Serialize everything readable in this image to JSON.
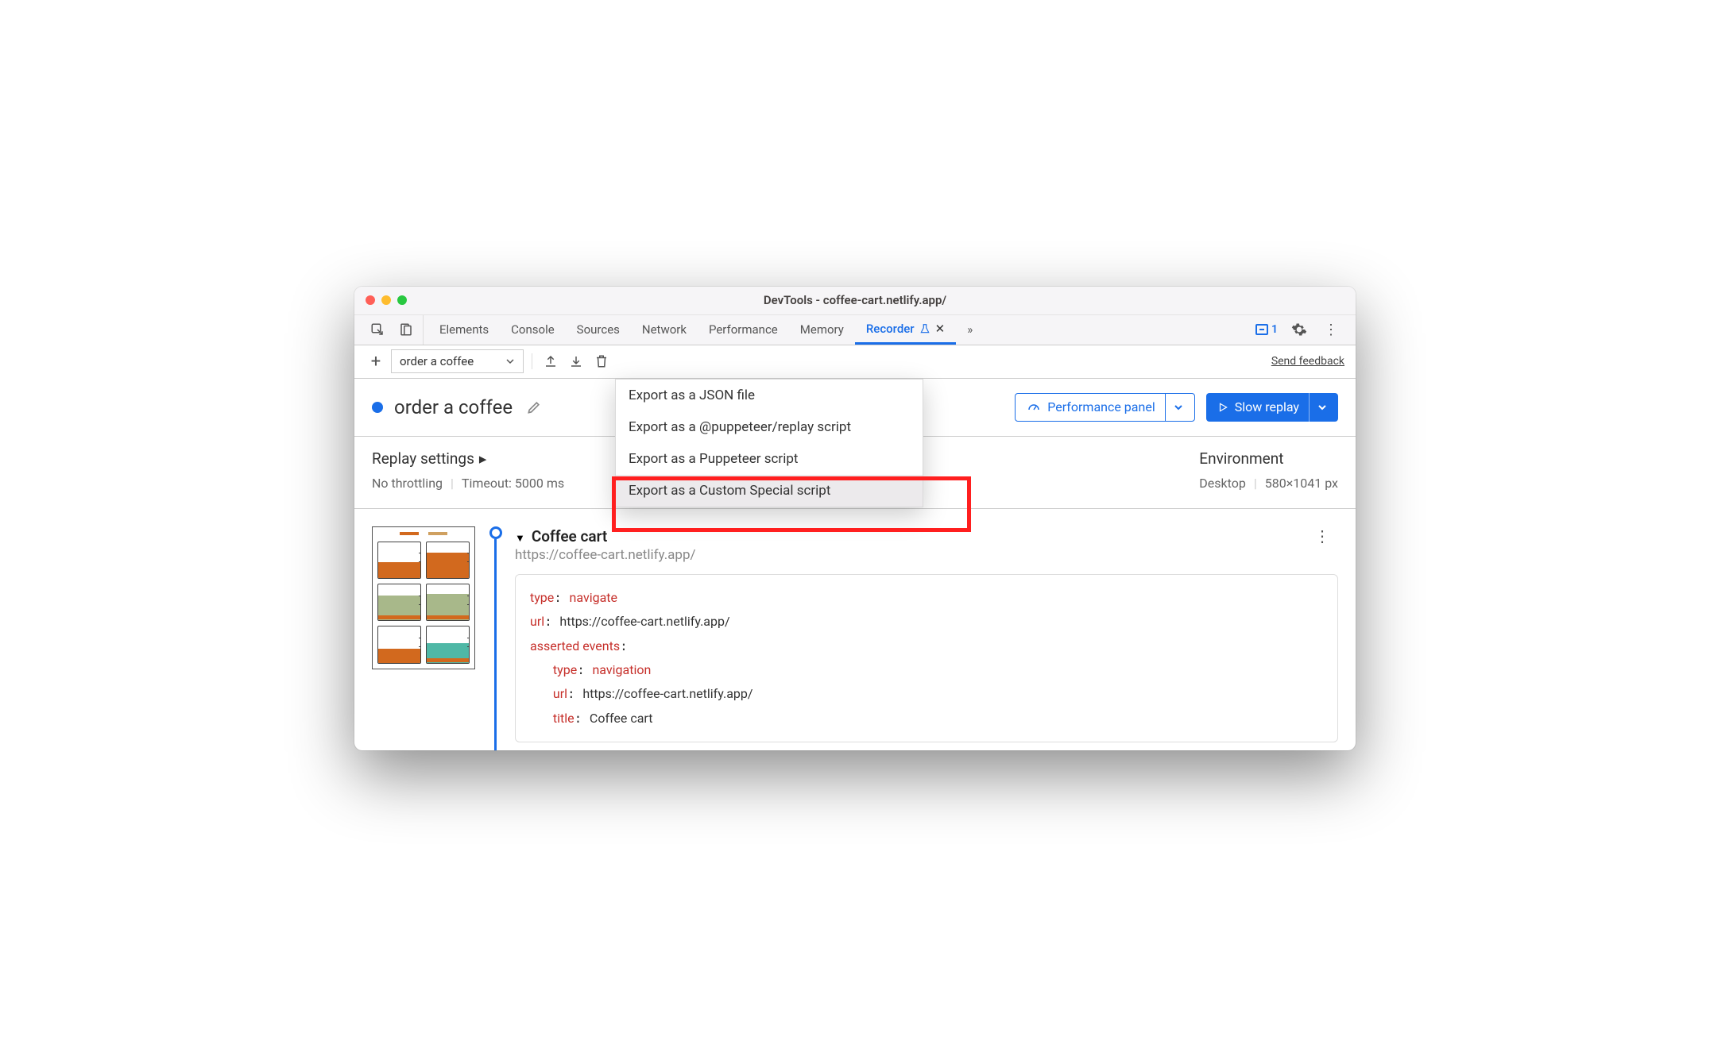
{
  "window": {
    "title": "DevTools - coffee-cart.netlify.app/"
  },
  "tabs": {
    "items": [
      "Elements",
      "Console",
      "Sources",
      "Network",
      "Performance",
      "Memory",
      "Recorder"
    ],
    "active": "Recorder",
    "issues_count": "1"
  },
  "toolbar": {
    "recording_name": "order a coffee",
    "feedback_label": "Send feedback"
  },
  "export_menu": {
    "items": [
      "Export as a JSON file",
      "Export as a @puppeteer/replay script",
      "Export as a Puppeteer script",
      "Export as a Custom Special script"
    ]
  },
  "header": {
    "title": "order a coffee",
    "perf_button": "Performance panel",
    "replay_button": "Slow replay"
  },
  "settings": {
    "title": "Replay settings",
    "throttling": "No throttling",
    "timeout": "Timeout: 5000 ms",
    "env_title": "Environment",
    "env_device": "Desktop",
    "env_size": "580×1041 px"
  },
  "step": {
    "title": "Coffee cart",
    "url": "https://coffee-cart.netlify.app/",
    "code": {
      "l1k": "type",
      "l1v": "navigate",
      "l2k": "url",
      "l2v": "https://coffee-cart.netlify.app/",
      "l3k": "asserted events",
      "l4k": "type",
      "l4v": "navigation",
      "l5k": "url",
      "l5v": "https://coffee-cart.netlify.app/",
      "l6k": "title",
      "l6v": "Coffee cart"
    }
  }
}
